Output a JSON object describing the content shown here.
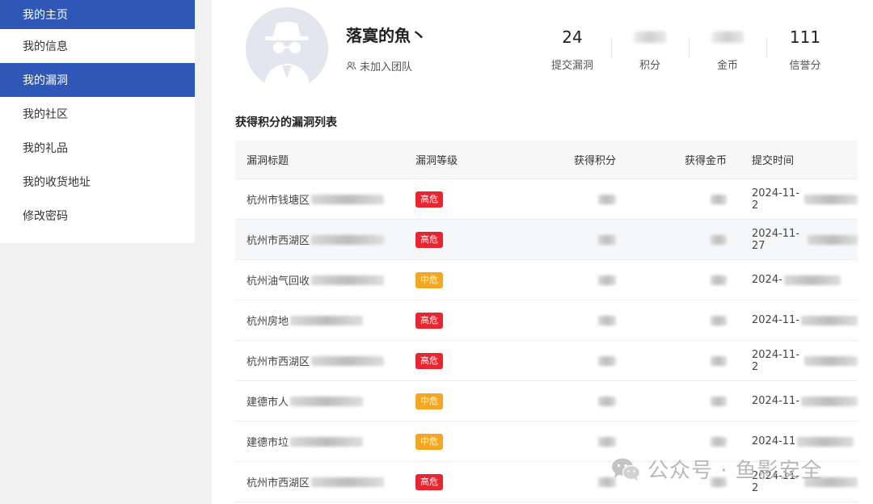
{
  "sidebar": {
    "items": [
      {
        "label": "我的主页",
        "active": true
      },
      {
        "label": "我的信息",
        "active": false
      },
      {
        "label": "我的漏洞",
        "active": true
      },
      {
        "label": "我的社区",
        "active": false
      },
      {
        "label": "我的礼品",
        "active": false
      },
      {
        "label": "我的收货地址",
        "active": false
      },
      {
        "label": "修改密码",
        "active": false
      }
    ]
  },
  "profile": {
    "avatar_icon": "incognito-avatar-icon",
    "username": "落寞的魚丶",
    "team_icon": "users-icon",
    "team_status": "未加入团队",
    "stats": [
      {
        "value": "24",
        "label": "提交漏洞"
      },
      {
        "value": "",
        "label": "积分"
      },
      {
        "value": "",
        "label": "金币"
      },
      {
        "value": "111",
        "label": "信誉分"
      }
    ]
  },
  "table": {
    "title": "获得积分的漏洞列表",
    "headers": [
      "漏洞标题",
      "漏洞等级",
      "获得积分",
      "获得金币",
      "提交时间"
    ],
    "rows": [
      {
        "title": "杭州市钱塘区",
        "level": "高危",
        "level_type": "high",
        "time": "2024-11-2"
      },
      {
        "title": "杭州市西湖区",
        "level": "高危",
        "level_type": "high",
        "time": "2024-11-27"
      },
      {
        "title": "杭州油气回收",
        "level": "中危",
        "level_type": "mid",
        "time": "2024-"
      },
      {
        "title": "杭州房地",
        "level": "高危",
        "level_type": "high",
        "time": "2024-11-"
      },
      {
        "title": "杭州市西湖区",
        "level": "高危",
        "level_type": "high",
        "time": "2024-11-2"
      },
      {
        "title": "建德市人",
        "level": "中危",
        "level_type": "mid",
        "time": "2024-11-"
      },
      {
        "title": "建德市垃",
        "level": "中危",
        "level_type": "mid",
        "time": "2024-11"
      },
      {
        "title": "杭州市西湖区",
        "level": "高危",
        "level_type": "high",
        "time": "2024-11-2"
      }
    ]
  },
  "watermark": {
    "icon": "wechat-icon",
    "text": "公众号 · 鱼影安全"
  },
  "colors": {
    "primary": "#2f57b8",
    "high": "#e8262f",
    "mid": "#f5a623"
  }
}
